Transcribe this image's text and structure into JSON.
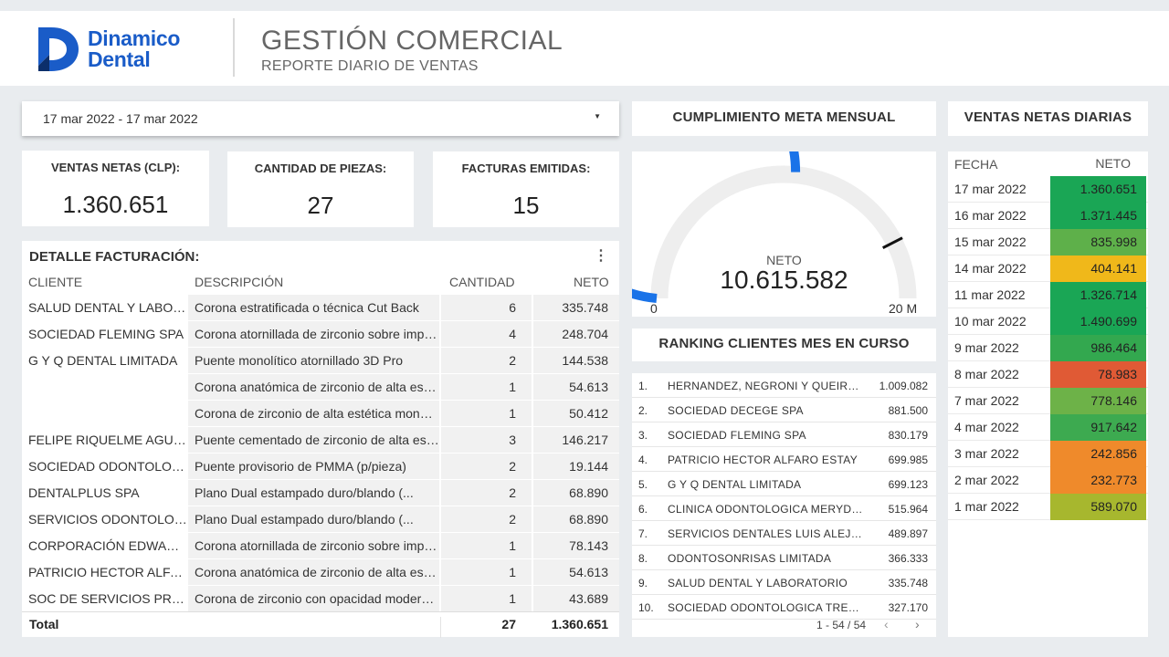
{
  "header": {
    "logo_line1": "Dinamico",
    "logo_line2": "Dental",
    "title": "GESTIÓN COMERCIAL",
    "subtitle": "REPORTE DIARIO DE VENTAS",
    "brand_color": "#1a5cc8"
  },
  "date_range": {
    "value": "17 mar 2022 - 17 mar 2022",
    "icon": "dropdown-triangle-icon"
  },
  "kpis": [
    {
      "label": "VENTAS NETAS (CLP):",
      "value": "1.360.651"
    },
    {
      "label": "CANTIDAD DE PIEZAS:",
      "value": "27"
    },
    {
      "label": "FACTURAS EMITIDAS:",
      "value": "15"
    }
  ],
  "detail": {
    "title": "DETALLE FACTURACIÓN:",
    "menu_icon": "kebab-menu-icon",
    "columns": [
      "CLIENTE",
      "DESCRIPCIÓN",
      "CANTIDAD",
      "NETO"
    ],
    "rows": [
      {
        "cliente": "SALUD DENTAL Y LABORATORIO",
        "descripcion": "Corona estratificada o técnica Cut Back",
        "cantidad": "6",
        "neto": "335.748"
      },
      {
        "cliente": "SOCIEDAD FLEMING SPA",
        "descripcion": "Corona atornillada de zirconio sobre implante",
        "cantidad": "4",
        "neto": "248.704"
      },
      {
        "cliente": "G Y Q DENTAL LIMITADA",
        "descripcion": "Puente monolítico atornillado 3D Pro",
        "cantidad": "2",
        "neto": "144.538"
      },
      {
        "cliente": "",
        "descripcion": "Corona anatómica de zirconio de alta estética",
        "cantidad": "1",
        "neto": "54.613"
      },
      {
        "cliente": "",
        "descripcion": "Corona de zirconio de alta estética monolítica",
        "cantidad": "1",
        "neto": "50.412"
      },
      {
        "cliente": "FELIPE RIQUELME AGUILERA",
        "descripcion": "Puente cementado de zirconio de alta estética",
        "cantidad": "3",
        "neto": "146.217"
      },
      {
        "cliente": "SOCIEDAD ODONTOLOGICA",
        "descripcion": "Puente provisorio de PMMA (p/pieza)",
        "cantidad": "2",
        "neto": "19.144"
      },
      {
        "cliente": "DENTALPLUS SPA",
        "descripcion": "Plano Dual estampado duro/blando (...",
        "cantidad": "2",
        "neto": "68.890"
      },
      {
        "cliente": "SERVICIOS ODONTOLOGICOS",
        "descripcion": "Plano Dual estampado duro/blando (...",
        "cantidad": "2",
        "neto": "68.890"
      },
      {
        "cliente": "CORPORACIÓN EDWARDS",
        "descripcion": "Corona atornillada de zirconio sobre implante",
        "cantidad": "1",
        "neto": "78.143"
      },
      {
        "cliente": "PATRICIO HECTOR ALFARO ESTAY",
        "descripcion": "Corona anatómica de zirconio de alta estética",
        "cantidad": "1",
        "neto": "54.613"
      },
      {
        "cliente": "SOC DE SERVICIOS PROFESIONALES",
        "descripcion": "Corona de zirconio con opacidad moderada",
        "cantidad": "1",
        "neto": "43.689"
      }
    ],
    "total_label": "Total",
    "total_cantidad": "27",
    "total_neto": "1.360.651"
  },
  "meta": {
    "title": "CUMPLIMIENTO META MENSUAL",
    "label": "NETO",
    "value": "10.615.582",
    "min_label": "0",
    "max_label": "20 M",
    "progress_fraction": 0.53,
    "target_fraction": 0.85,
    "arc_color": "#1a73e8",
    "track_color": "#eeeeee"
  },
  "ranking": {
    "title": "RANKING CLIENTES MES EN CURSO",
    "rows": [
      {
        "n": "1.",
        "name": "HERNANDEZ, NEGRONI Y QUEIROLO",
        "value": "1.009.082"
      },
      {
        "n": "2.",
        "name": "SOCIEDAD DECEGE SPA",
        "value": "881.500"
      },
      {
        "n": "3.",
        "name": "SOCIEDAD FLEMING SPA",
        "value": "830.179"
      },
      {
        "n": "4.",
        "name": "PATRICIO HECTOR ALFARO ESTAY",
        "value": "699.985"
      },
      {
        "n": "5.",
        "name": "G Y Q DENTAL LIMITADA",
        "value": "699.123"
      },
      {
        "n": "6.",
        "name": "CLINICA ODONTOLOGICA MERYDENT",
        "value": "515.964"
      },
      {
        "n": "7.",
        "name": "SERVICIOS DENTALES LUIS ALEJANDRO",
        "value": "489.897"
      },
      {
        "n": "8.",
        "name": "ODONTOSONRISAS LIMITADA",
        "value": "366.333"
      },
      {
        "n": "9.",
        "name": "SALUD DENTAL Y LABORATORIO",
        "value": "335.748"
      },
      {
        "n": "10.",
        "name": "SOCIEDAD ODONTOLOGICA TRES PUNTAS",
        "value": "327.170"
      }
    ],
    "pagination": "1 - 54 / 54",
    "prev_icon": "chevron-left-icon",
    "next_icon": "chevron-right-icon"
  },
  "daily": {
    "title": "VENTAS NETAS DIARIAS",
    "col_fecha": "FECHA",
    "col_neto": "NETO",
    "rows": [
      {
        "fecha": "17 mar 2022",
        "neto": "1.360.651",
        "color": "#1aa655"
      },
      {
        "fecha": "16 mar 2022",
        "neto": "1.371.445",
        "color": "#1aa655"
      },
      {
        "fecha": "15 mar 2022",
        "neto": "835.998",
        "color": "#5eb04a"
      },
      {
        "fecha": "14 mar 2022",
        "neto": "404.141",
        "color": "#f0b81a"
      },
      {
        "fecha": "11 mar 2022",
        "neto": "1.326.714",
        "color": "#1aa655"
      },
      {
        "fecha": "10 mar 2022",
        "neto": "1.490.699",
        "color": "#1aa655"
      },
      {
        "fecha": "9 mar 2022",
        "neto": "986.464",
        "color": "#33a84f"
      },
      {
        "fecha": "8 mar 2022",
        "neto": "78.983",
        "color": "#e05a35"
      },
      {
        "fecha": "7 mar 2022",
        "neto": "778.146",
        "color": "#6db248"
      },
      {
        "fecha": "4 mar 2022",
        "neto": "917.642",
        "color": "#3daa50"
      },
      {
        "fecha": "3 mar 2022",
        "neto": "242.856",
        "color": "#ef8a2b"
      },
      {
        "fecha": "2 mar 2022",
        "neto": "232.773",
        "color": "#ef8a2b"
      },
      {
        "fecha": "1 mar 2022",
        "neto": "589.070",
        "color": "#a7b72e"
      }
    ]
  }
}
